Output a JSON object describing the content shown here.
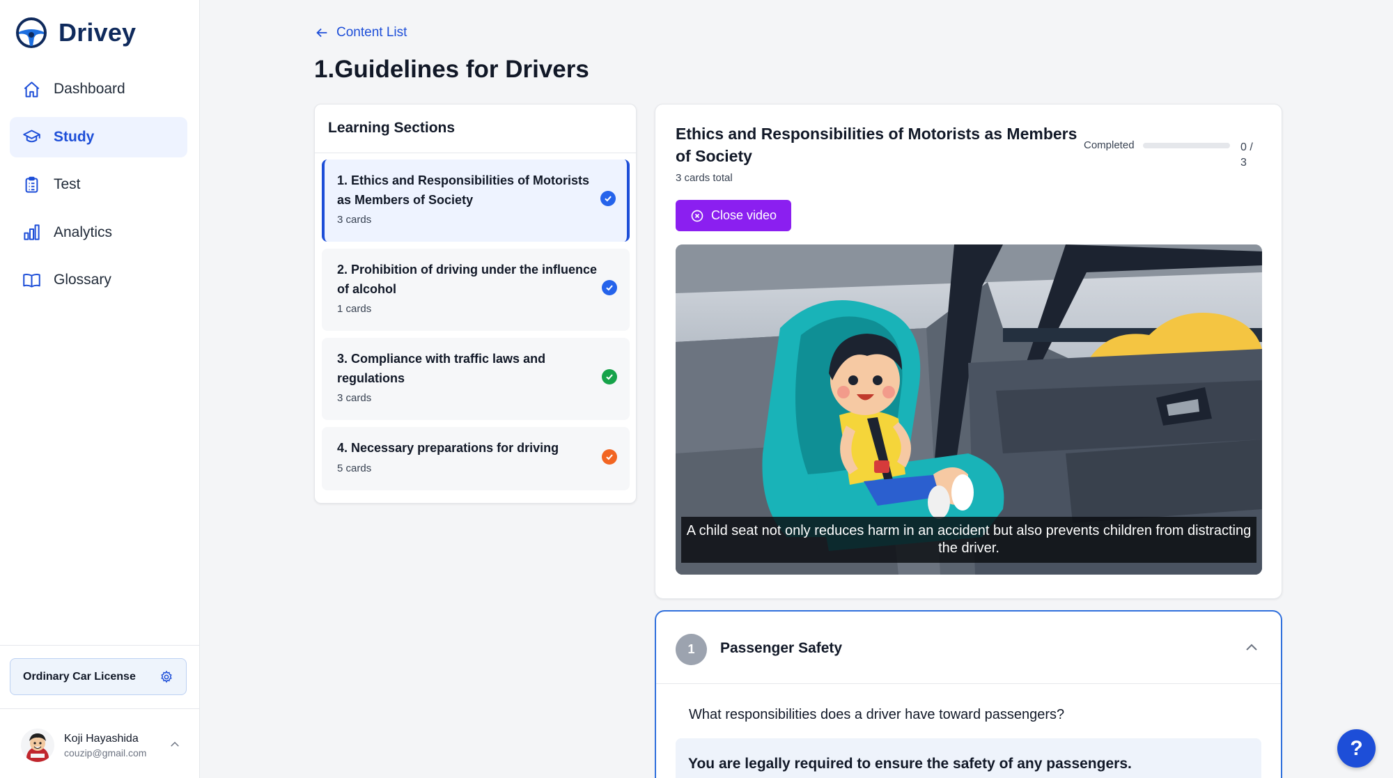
{
  "app": {
    "name": "Drivey"
  },
  "sidebar": {
    "items": [
      {
        "label": "Dashboard",
        "icon": "home-icon",
        "active": false
      },
      {
        "label": "Study",
        "icon": "graduation-cap-icon",
        "active": true
      },
      {
        "label": "Test",
        "icon": "clipboard-icon",
        "active": false
      },
      {
        "label": "Analytics",
        "icon": "bar-chart-icon",
        "active": false
      },
      {
        "label": "Glossary",
        "icon": "book-open-icon",
        "active": false
      }
    ],
    "license": {
      "label": "Ordinary Car License",
      "icon": "gear-icon"
    },
    "user": {
      "name": "Koji Hayashida",
      "email": "couzip@gmail.com"
    }
  },
  "header": {
    "back_label": "Content List",
    "title": "1.Guidelines for Drivers"
  },
  "sections": {
    "heading": "Learning Sections",
    "items": [
      {
        "title": "1. Ethics and Responsibilities of Motorists as Members of Society",
        "count": "3 cards",
        "status_color": "#2563eb",
        "active": true
      },
      {
        "title": "2. Prohibition of driving under the influence of alcohol",
        "count": "1 cards",
        "status_color": "#2563eb",
        "active": false
      },
      {
        "title": "3. Compliance with traffic laws and regulations",
        "count": "3 cards",
        "status_color": "#16a34a",
        "active": false
      },
      {
        "title": "4. Necessary preparations for driving",
        "count": "5 cards",
        "status_color": "#f26522",
        "active": false
      }
    ]
  },
  "detail": {
    "title": "Ethics and Responsibilities of Motorists as Members of Society",
    "subtitle": "3 cards total",
    "progress_label": "Completed",
    "progress_value": 0,
    "progress_count": "0 / 3",
    "close_video_label": "Close video",
    "caption": "A child seat not only reduces harm in an accident but also prevents children from distracting the driver."
  },
  "card": {
    "number": "1",
    "title": "Passenger Safety",
    "question": "What responsibilities does a driver have toward passengers?",
    "answer": "You are legally required to ensure the safety of any passengers."
  },
  "help": {
    "label": "?"
  },
  "colors": {
    "primary": "#1d4ed8",
    "video_button": "#8b1ff0",
    "brand_text": "#0f2a5c"
  }
}
